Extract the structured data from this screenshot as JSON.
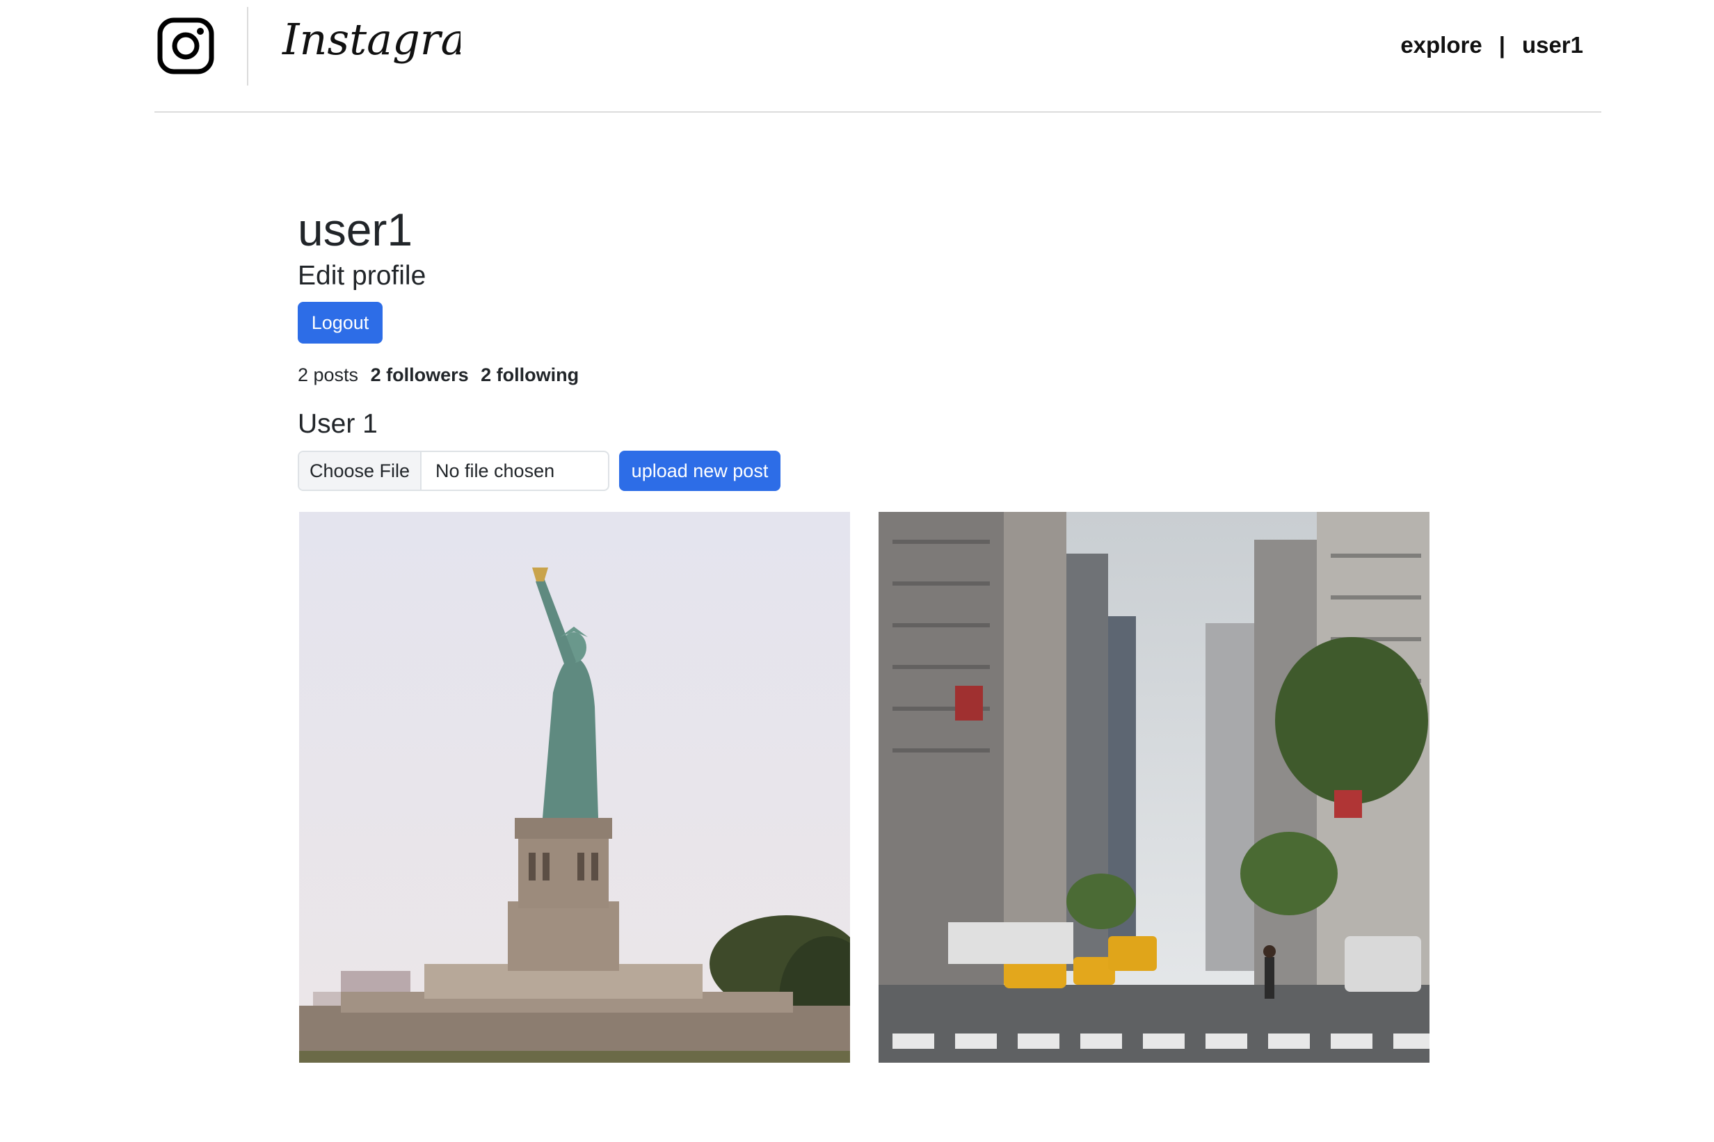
{
  "header": {
    "brand": "Instagram",
    "nav": {
      "explore": "explore",
      "separator": "|",
      "user": "user1"
    }
  },
  "profile": {
    "username": "user1",
    "edit_profile": "Edit profile",
    "logout": "Logout",
    "stats": {
      "posts": "2 posts",
      "followers": "2 followers",
      "following": "2 following"
    },
    "full_name": "User 1",
    "upload": {
      "choose_file": "Choose File",
      "no_file": "No file chosen",
      "submit": "upload new post"
    }
  },
  "posts": [
    {
      "subject": "statue-of-liberty"
    },
    {
      "subject": "city-street"
    }
  ],
  "colors": {
    "primary": "#2d6de7",
    "text": "#212529",
    "divider": "#dcdcdc"
  },
  "icons": [
    "instagram-logo-icon"
  ]
}
